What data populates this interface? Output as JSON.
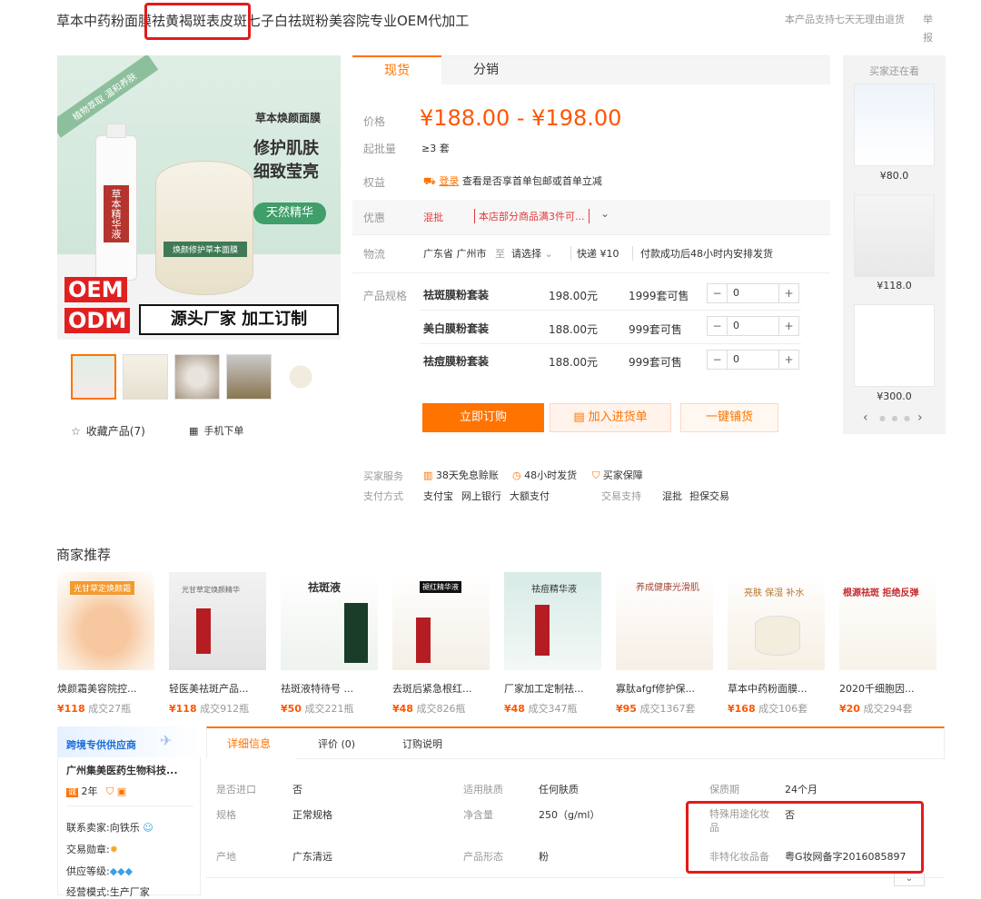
{
  "title": "草本中药粉面膜祛黄褐斑表皮斑七子白祛斑粉美容院专业OEM代加工",
  "return_policy": "本产品支持七天无理由退货",
  "report": "举报",
  "main_image": {
    "badge_left": "植物萃取 温和养肤",
    "product_name": "草本焕颜面膜",
    "slogan1": "修护肌肤",
    "slogan2": "细致莹亮",
    "tag": "天然精华",
    "bottle_text": "草本精华液",
    "jar_text": "焕颜修护草本面膜",
    "oem": "OEM",
    "odm": "ODM",
    "banner": "源头厂家 加工订制"
  },
  "favorite": "收藏产品(7)",
  "mobile_order": "手机下单",
  "tabs": [
    "现货",
    "分销"
  ],
  "labels": {
    "price": "价格",
    "moq": "起批量",
    "rights": "权益",
    "discount": "优惠",
    "logistics": "物流",
    "spec": "产品规格"
  },
  "price_range": "¥188.00 - ¥198.00",
  "moq_value": "≥3 套",
  "rights": {
    "login": "登录",
    "text": "查看是否享首单包邮或首单立减"
  },
  "discount": {
    "tag": "混批",
    "text": "本店部分商品满3件可...",
    "more": "⌄"
  },
  "logistics": {
    "from": "广东省 广州市",
    "to_label": "至",
    "to": "请选择",
    "express": "快递 ¥10",
    "ship": "付款成功后48小时内安排发货"
  },
  "skus": [
    {
      "name": "祛斑膜粉套装",
      "price": "198.00元",
      "stock": "1999套可售",
      "qty": "0"
    },
    {
      "name": "美白膜粉套装",
      "price": "188.00元",
      "stock": "999套可售",
      "qty": "0"
    },
    {
      "name": "祛痘膜粉套装",
      "price": "188.00元",
      "stock": "999套可售",
      "qty": "0"
    }
  ],
  "buttons": {
    "order": "立即订购",
    "cart": "加入进货单",
    "one_click": "一键铺货"
  },
  "buyers_also": {
    "title": "买家还在看",
    "items": [
      {
        "price": "¥80.0"
      },
      {
        "price": "¥118.0"
      },
      {
        "price": "¥300.0"
      }
    ]
  },
  "services": {
    "label": "买家服务",
    "items": [
      "38天免息赊账",
      "48小时发货",
      "买家保障"
    ],
    "pay_label": "支付方式",
    "pay": [
      "支付宝",
      "网上银行",
      "大额支付"
    ],
    "trade_label": "交易支持",
    "trade": [
      "混批",
      "担保交易"
    ]
  },
  "merchant_rec": {
    "title": "商家推荐",
    "items": [
      {
        "name": "焕颜霜美容院控...",
        "price": "¥118",
        "sold": "成交27瓶"
      },
      {
        "name": "轻医美祛斑产品...",
        "price": "¥118",
        "sold": "成交912瓶"
      },
      {
        "name": "祛斑液特待号 ...",
        "price": "¥50",
        "sold": "成交221瓶"
      },
      {
        "name": "去斑后紧急根红...",
        "price": "¥48",
        "sold": "成交826瓶"
      },
      {
        "name": "厂家加工定制祛...",
        "price": "¥48",
        "sold": "成交347瓶"
      },
      {
        "name": "寡肽afgf修护保...",
        "price": "¥95",
        "sold": "成交1367套"
      },
      {
        "name": "草本中药粉面膜...",
        "price": "¥168",
        "sold": "成交106套"
      },
      {
        "name": "2020千细胞因...",
        "price": "¥20",
        "sold": "成交294套"
      }
    ],
    "images": [
      {
        "text": "光甘草定焕颜霜"
      },
      {
        "text": "光甘草定焕颜精华"
      },
      {
        "text": "祛斑液"
      },
      {
        "text": "褪红精华液"
      },
      {
        "text": "祛痘精华液"
      },
      {
        "text": "养成健康光滑肌"
      },
      {
        "text": "亮肤 保湿 补水"
      },
      {
        "text": "根源祛斑 拒绝反弹"
      }
    ]
  },
  "supplier": {
    "banner": "跨境专供供应商",
    "name": "广州集美医药生物科技...",
    "years": "2年",
    "contact_label": "联系卖家:",
    "contact": "向铁乐",
    "medal_label": "交易勋章:",
    "level_label": "供应等级:",
    "mode_label": "经营模式:",
    "mode": "生产厂家"
  },
  "detail_tabs": [
    "详细信息",
    "评价 (0)",
    "订购说明"
  ],
  "attributes": [
    {
      "label": "是否进口",
      "value": "否"
    },
    {
      "label": "适用肤质",
      "value": "任何肤质"
    },
    {
      "label": "保质期",
      "value": "24个月"
    },
    {
      "label": "规格",
      "value": "正常规格"
    },
    {
      "label": "净含量",
      "value": "250（g/ml）"
    },
    {
      "label": "特殊用途化妆品",
      "value": "否"
    },
    {
      "label": "产地",
      "value": "广东清远"
    },
    {
      "label": "产品形态",
      "value": "粉"
    },
    {
      "label": "非特化妆品备",
      "value": "粤G妆网备字2016085897"
    }
  ],
  "colors": {
    "accent": "#ff7300",
    "price": "#ff5500",
    "highlight_box": "#e21b1b"
  }
}
